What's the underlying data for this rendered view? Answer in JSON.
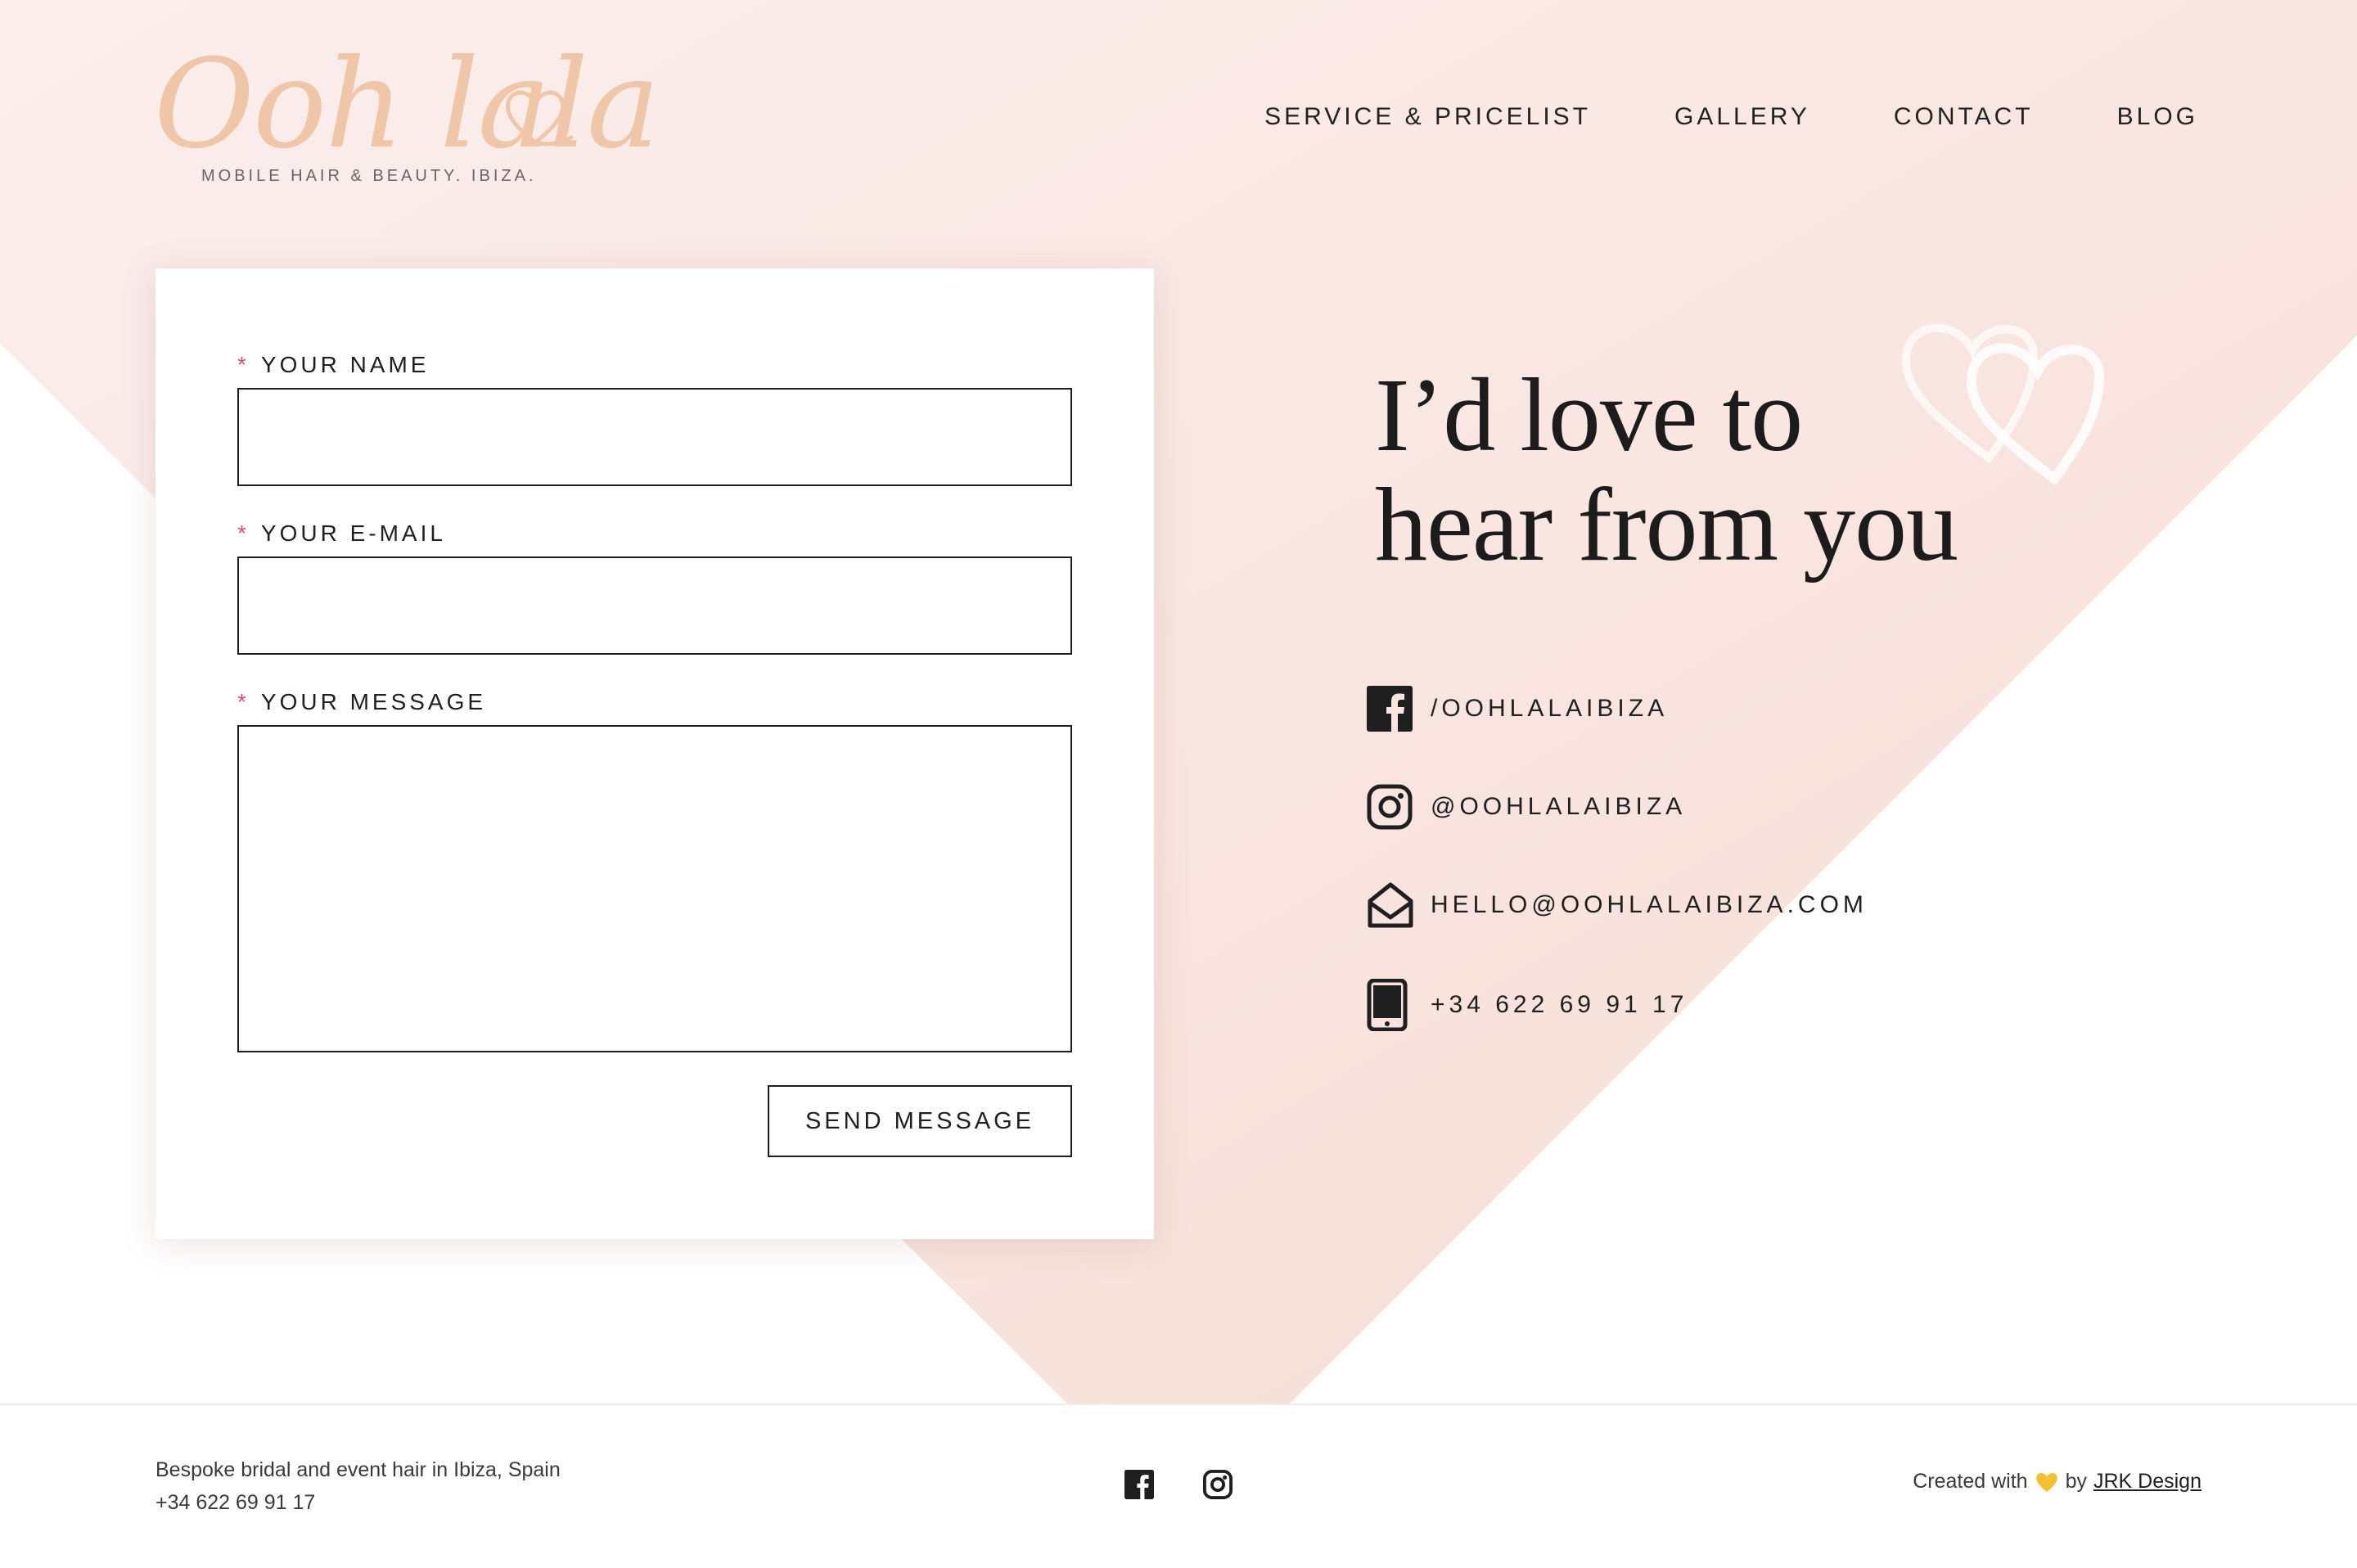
{
  "header": {
    "logo_script": "Ooh lala",
    "logo_tagline": "MOBILE HAIR & BEAUTY. IBIZA.",
    "nav": [
      {
        "label": "SERVICE & PRICELIST"
      },
      {
        "label": "GALLERY"
      },
      {
        "label": "CONTACT"
      },
      {
        "label": "BLOG"
      }
    ]
  },
  "form": {
    "required_marker": "*",
    "name_label": "YOUR NAME",
    "email_label": "YOUR E-MAIL",
    "message_label": "YOUR MESSAGE",
    "name_value": "",
    "email_value": "",
    "message_value": "",
    "send_label": "SEND MESSAGE"
  },
  "contact": {
    "headline_line1": "I’d love to",
    "headline_line2": "hear from you",
    "items": [
      {
        "icon": "facebook-icon",
        "text": "/OOHLALAIBIZA"
      },
      {
        "icon": "instagram-icon",
        "text": "@OOHLALAIBIZA"
      },
      {
        "icon": "envelope-open-icon",
        "text": "HELLO@OOHLALAIBIZA.COM"
      },
      {
        "icon": "mobile-phone-icon",
        "text": "+34 622 69 91 17"
      }
    ]
  },
  "footer": {
    "line1": "Bespoke bridal and event hair in Ibiza, Spain",
    "line2": "+34 622 69 91 17",
    "social": [
      "facebook-icon",
      "instagram-icon"
    ],
    "created_prefix": "Created with",
    "created_by": "by",
    "designer": "JRK Design"
  },
  "colors": {
    "background_pink": "#f9e4df",
    "logo_peach": "#efc6a8",
    "required_red": "#d15472",
    "heart_yellow": "#f3c02f",
    "text_dark": "#1f1f1f"
  }
}
